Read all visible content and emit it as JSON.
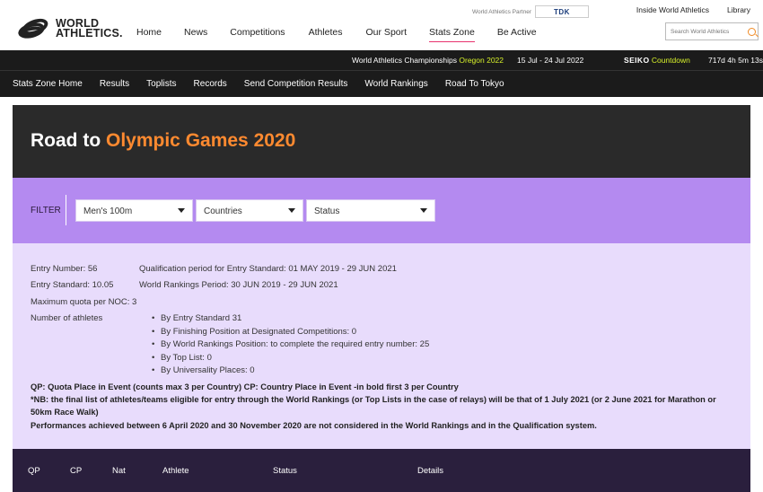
{
  "header": {
    "logo_line1": "WORLD",
    "logo_line2": "ATHLETICS.",
    "nav": [
      "Home",
      "News",
      "Competitions",
      "Athletes",
      "Our Sport",
      "Stats Zone",
      "Be Active"
    ],
    "active_nav": "Stats Zone",
    "partner_label": "World Athletics Partner",
    "partner_name": "TDK",
    "top_links": [
      "Inside World Athletics",
      "Library"
    ],
    "search_placeholder": "Search World Athletics"
  },
  "event_bar": {
    "event_name": "World Athletics Championships",
    "event_place": "Oregon 2022",
    "dates": "15 Jul - 24 Jul 2022",
    "sponsor": "SEIKO",
    "countdown_label": "Countdown",
    "timer": "717d 4h 5m 13s"
  },
  "subnav": [
    "Stats Zone Home",
    "Results",
    "Toplists",
    "Records",
    "Send Competition Results",
    "World Rankings",
    "Road To Tokyo"
  ],
  "page": {
    "title_prefix": "Road to",
    "title_accent": "Olympic Games 2020"
  },
  "filter": {
    "label": "FILTER",
    "event": "Men's 100m",
    "countries": "Countries",
    "status": "Status"
  },
  "info": {
    "entry_number": "Entry Number: 56",
    "entry_standard": "Entry Standard: 10.05",
    "quota": "Maximum quota per NOC: 3",
    "athletes_label": "Number of athletes",
    "qual_period": "Qualification period for Entry Standard: 01 MAY 2019 - 29 JUN 2021",
    "rankings_period": "World Rankings Period: 30 JUN 2019 - 29 JUN 2021",
    "breakdown": [
      "By Entry Standard 31",
      "By Finishing Position at Designated Competitions: 0",
      "By World Rankings Position: to complete the required entry number: 25",
      "By Top List: 0",
      "By Universality Places: 0"
    ],
    "legend": "QP: Quota Place in Event (counts max 3 per Country) CP: Country Place in Event -in bold first 3 per Country",
    "note": "*NB: the final list of athletes/teams eligible for entry through the World Rankings (or Top Lists in the case of relays) will be that of 1 July 2021 (or 2 June 2021 for Marathon or 50km Race Walk)",
    "performances": "Performances achieved between 6 April 2020 and 30 November 2020 are not considered in the World Rankings and in the Qualification system."
  },
  "table": {
    "columns": [
      "QP",
      "CP",
      "Nat",
      "Athlete",
      "Status",
      "Details"
    ]
  }
}
